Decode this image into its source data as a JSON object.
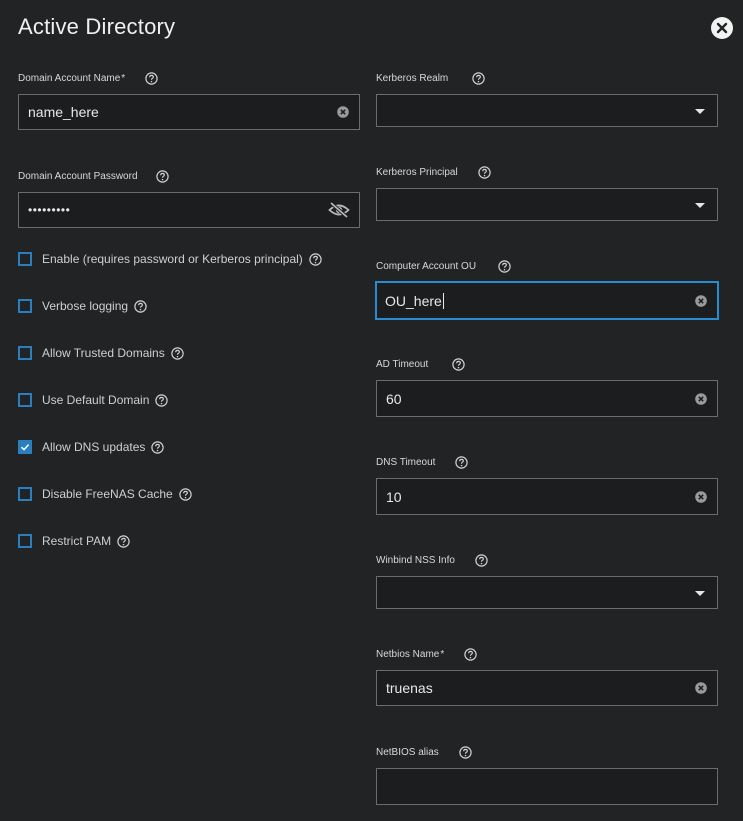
{
  "dialog": {
    "title": "Active Directory"
  },
  "left_fields": {
    "domain_account_name": {
      "label": "Domain Account Name",
      "required_mark": "*",
      "value": "name_here"
    },
    "domain_account_password": {
      "label": "Domain Account Password",
      "value": "•••••••••"
    }
  },
  "checkboxes": [
    {
      "label": "Enable (requires password or Kerberos principal)",
      "checked": false
    },
    {
      "label": "Verbose logging",
      "checked": false
    },
    {
      "label": "Allow Trusted Domains",
      "checked": false
    },
    {
      "label": "Use Default Domain",
      "checked": false
    },
    {
      "label": "Allow DNS updates",
      "checked": true
    },
    {
      "label": "Disable FreeNAS Cache",
      "checked": false
    },
    {
      "label": "Restrict PAM",
      "checked": false
    }
  ],
  "right_fields": {
    "kerberos_realm": {
      "label": "Kerberos Realm",
      "value": ""
    },
    "kerberos_principal": {
      "label": "Kerberos Principal",
      "value": ""
    },
    "computer_account_ou": {
      "label": "Computer Account OU",
      "value": "OU_here"
    },
    "ad_timeout": {
      "label": "AD Timeout",
      "value": "60"
    },
    "dns_timeout": {
      "label": "DNS Timeout",
      "value": "10"
    },
    "winbind_nss_info": {
      "label": "Winbind NSS Info",
      "value": ""
    },
    "netbios_name": {
      "label": "Netbios Name",
      "required_mark": "*",
      "value": "truenas"
    },
    "netbios_alias": {
      "label": "NetBIOS alias",
      "value": ""
    }
  },
  "icons": {
    "close": "close-icon",
    "help": "help-circle-icon",
    "clear": "clear-circle-icon",
    "dropdown": "chevron-down-icon",
    "visibility": "visibility-off-icon",
    "check": "check-icon"
  },
  "colors": {
    "background": "#222324",
    "accent": "#2a7fc0",
    "focus_border": "#2a8bd0",
    "field_border": "#6a6b6c"
  }
}
